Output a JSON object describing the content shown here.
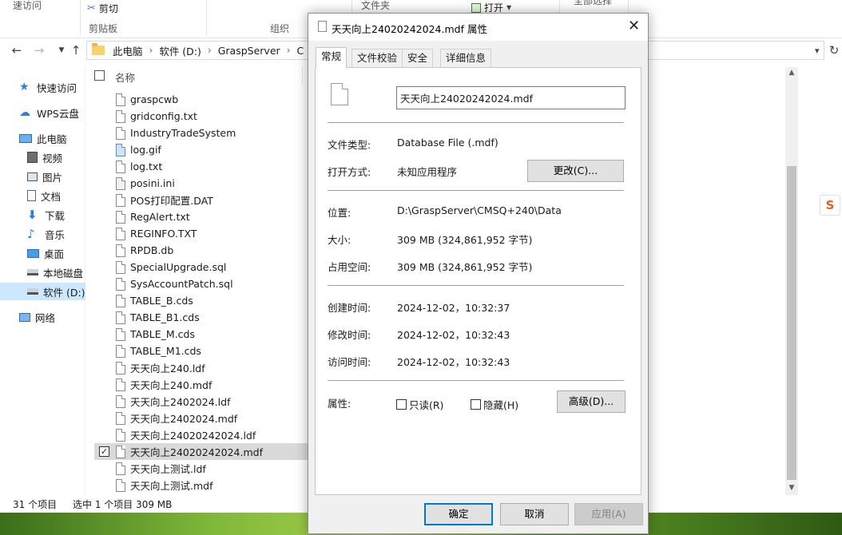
{
  "ribbon": {
    "quick_access_fragment": "速访问",
    "cut_label": "剪切",
    "clipboard_group": "剪贴板",
    "organize_group": "组织",
    "folder_fragment": "文件夹",
    "open_label": "打开",
    "select_all_fragment": "全部选择"
  },
  "address": {
    "crumbs": [
      "此电脑",
      "软件 (D:)",
      "GraspServer",
      "C"
    ]
  },
  "sidebar": {
    "items": [
      {
        "label": "快速访问",
        "icon": "star-icon"
      },
      {
        "label": "WPS云盘",
        "icon": "cloud-icon"
      },
      {
        "label": "此电脑",
        "icon": "computer-icon"
      },
      {
        "label": "视频",
        "icon": "video-icon"
      },
      {
        "label": "图片",
        "icon": "picture-icon"
      },
      {
        "label": "文档",
        "icon": "document-icon"
      },
      {
        "label": "下载",
        "icon": "download-icon"
      },
      {
        "label": "音乐",
        "icon": "music-icon"
      },
      {
        "label": "桌面",
        "icon": "desktop-icon"
      },
      {
        "label": "本地磁盘",
        "icon": "drive-icon"
      },
      {
        "label": "软件 (D:)",
        "icon": "drive-icon"
      },
      {
        "label": "网络",
        "icon": "network-icon"
      }
    ]
  },
  "filelist": {
    "column_name": "名称",
    "files": [
      "graspcwb",
      "gridconfig.txt",
      "IndustryTradeSystem",
      "log.gif",
      "log.txt",
      "posini.ini",
      "POS打印配置.DAT",
      "RegAlert.txt",
      "REGINFO.TXT",
      "RPDB.db",
      "SpecialUpgrade.sql",
      "SysAccountPatch.sql",
      "TABLE_B.cds",
      "TABLE_B1.cds",
      "TABLE_M.cds",
      "TABLE_M1.cds",
      "天天向上240.ldf",
      "天天向上240.mdf",
      "天天向上2402024.ldf",
      "天天向上2402024.mdf",
      "天天向上24020242024.ldf",
      "天天向上24020242024.mdf",
      "天天向上测试.ldf",
      "天天向上测试.mdf"
    ],
    "selected_index": 21
  },
  "status": {
    "item_count": "31 个项目",
    "selection": "选中 1 个项目  309 MB"
  },
  "dialog": {
    "title": "天天向上24020242024.mdf 属性",
    "tabs": [
      "常规",
      "文件校验",
      "安全",
      "详细信息"
    ],
    "file_name": "天天向上24020242024.mdf",
    "type_label": "文件类型:",
    "type_value": "Database File (.mdf)",
    "open_with_label": "打开方式:",
    "open_with_value": "未知应用程序",
    "change_button": "更改(C)...",
    "location_label": "位置:",
    "location_value": "D:\\GraspServer\\CMSQ+240\\Data",
    "size_label": "大小:",
    "size_value": "309 MB (324,861,952 字节)",
    "size_on_disk_label": "占用空间:",
    "size_on_disk_value": "309 MB (324,861,952 字节)",
    "created_label": "创建时间:",
    "created_value": "2024-12-02，10:32:37",
    "modified_label": "修改时间:",
    "modified_value": "2024-12-02，10:32:43",
    "accessed_label": "访问时间:",
    "accessed_value": "2024-12-02，10:32:43",
    "attributes_label": "属性:",
    "readonly_label": "只读(R)",
    "hidden_label": "隐藏(H)",
    "advanced_button": "高级(D)...",
    "ok_button": "确定",
    "cancel_button": "取消",
    "apply_button": "应用(A)"
  },
  "colors": {
    "selection_blue": "#cce8ff",
    "accent": "#0078d7",
    "sogou_orange": "#ee5b27"
  }
}
